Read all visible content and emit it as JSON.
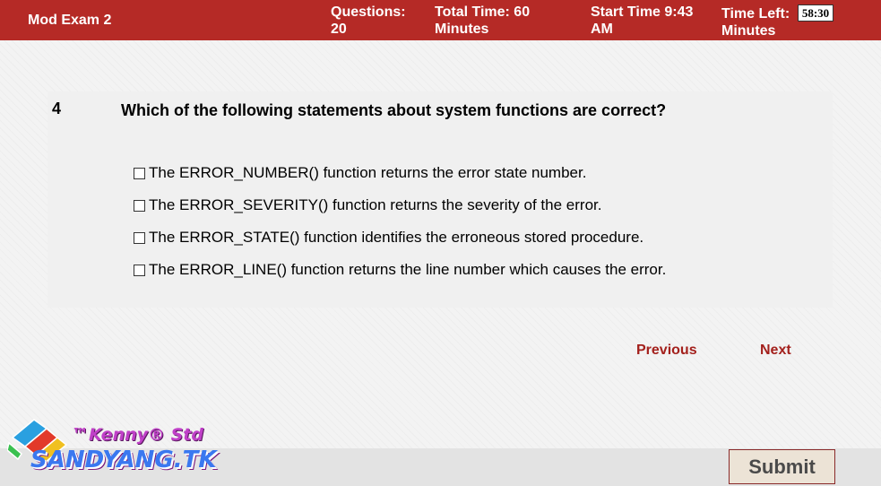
{
  "header": {
    "exam_title": "Mod Exam 2",
    "questions": "Questions:\n20",
    "total_time": "Total Time:  60\nMinutes",
    "start_time": "Start Time  9:43\nAM",
    "time_left_label": "Time Left:\nMinutes",
    "time_left_value": "58:30"
  },
  "question": {
    "number": "4",
    "text": "Which of the following statements about system functions are correct?",
    "options": [
      {
        "label": "The ERROR_NUMBER() function returns the error state number.",
        "checked": false
      },
      {
        "label": "The ERROR_SEVERITY() function returns the severity of the error.",
        "checked": false
      },
      {
        "label": "The ERROR_STATE() function identifies the erroneous stored procedure.",
        "checked": false
      },
      {
        "label": "The ERROR_LINE() function returns the line number which causes the error.",
        "checked": false
      }
    ]
  },
  "navigation": {
    "previous_label": "Previous",
    "next_label": "Next"
  },
  "footer": {
    "submit_label": "Submit"
  },
  "watermark": {
    "brand_line": "™Kenny® Std",
    "site": "SANDYANG.TK"
  },
  "colors": {
    "header_bg": "#b52a26",
    "nav_link": "#a3201c",
    "submit_bg": "#ece3d6"
  }
}
